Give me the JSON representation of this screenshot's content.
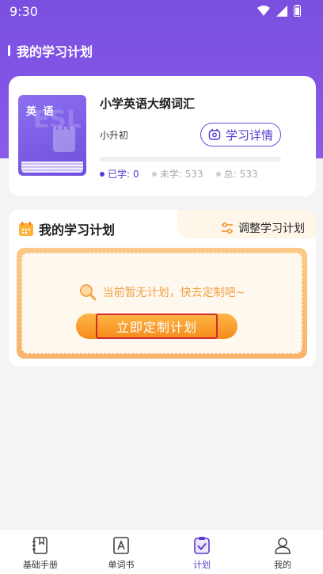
{
  "status_bar": {
    "time": "9:30"
  },
  "page": {
    "title": "我的学习计划"
  },
  "book": {
    "cover_label": "英 语",
    "cover_decoration": "ESL",
    "title": "小学英语大纲词汇",
    "subtitle": "小升初",
    "detail_button": "学习详情",
    "progress": 0,
    "stats": {
      "learned_label": "已学:",
      "learned_value": "0",
      "unlearned_label": "未学:",
      "unlearned_value": "533",
      "total_label": "总:",
      "total_value": "533"
    }
  },
  "plan": {
    "title": "我的学习计划",
    "adjust_label": "调整学习计划",
    "empty_message": "当前暂无计划，快去定制吧~",
    "create_button": "立即定制计划"
  },
  "bottom_nav": {
    "items": [
      {
        "label": "基础手册",
        "icon": "handbook-icon"
      },
      {
        "label": "单词书",
        "icon": "wordbook-icon"
      },
      {
        "label": "计划",
        "icon": "plan-icon"
      },
      {
        "label": "我的",
        "icon": "profile-icon"
      }
    ],
    "active_index": 2
  },
  "colors": {
    "primary": "#6b48d8",
    "header": "#7a4fe0",
    "accent_orange": "#f58c1a",
    "empty_text": "#f0a24a"
  }
}
